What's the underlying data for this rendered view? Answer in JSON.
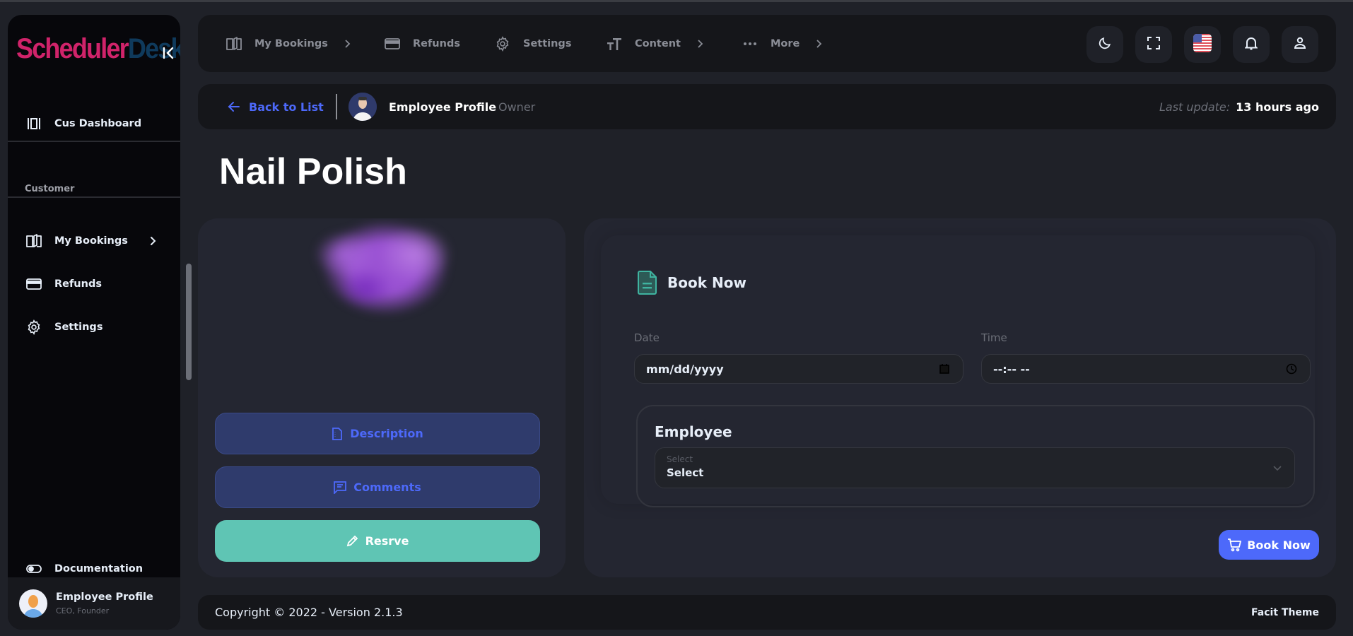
{
  "brand": {
    "part1": "Scheduler",
    "part2": "Desk"
  },
  "sidebar": {
    "dashboard": {
      "label": "Cus Dashboard",
      "icon": "dashboard-icon"
    },
    "section_label": "Customer",
    "items": [
      {
        "label": "My Bookings",
        "icon": "book-icon",
        "has_chevron": true
      },
      {
        "label": "Refunds",
        "icon": "credit-card-icon",
        "has_chevron": false
      },
      {
        "label": "Settings",
        "icon": "gear-icon",
        "has_chevron": false
      }
    ],
    "documentation": {
      "label": "Documentation",
      "icon": "toggle-icon"
    },
    "user": {
      "name": "Employee Profile",
      "role": "CEO, Founder"
    }
  },
  "header": {
    "nav": [
      {
        "label": "My Bookings",
        "icon": "book-icon",
        "has_chevron": true
      },
      {
        "label": "Refunds",
        "icon": "credit-card-icon",
        "has_chevron": false
      },
      {
        "label": "Settings",
        "icon": "gear-icon",
        "has_chevron": false
      },
      {
        "label": "Content",
        "icon": "text-size-icon",
        "has_chevron": true
      },
      {
        "label": "More",
        "icon": "more-dots-icon",
        "has_chevron": true
      }
    ],
    "actions": [
      "dark-mode-icon",
      "fullscreen-icon",
      "us-flag-icon",
      "bell-icon",
      "user-icon"
    ]
  },
  "subheader": {
    "back_label": "Back to List",
    "profile_name": "Employee Profile",
    "profile_role": "Owner",
    "last_update_label": "Last update:",
    "last_update_value": "13 hours ago"
  },
  "page": {
    "title": "Nail Polish"
  },
  "left_card": {
    "buttons": [
      {
        "label": "Description",
        "icon": "document-icon"
      },
      {
        "label": "Comments",
        "icon": "comment-icon"
      },
      {
        "label": "Resrve",
        "icon": "pencil-icon"
      }
    ]
  },
  "booking": {
    "title": "Book Now",
    "date_label": "Date",
    "date_placeholder": "mm/dd/yyyy",
    "time_label": "Time",
    "time_placeholder": "--:-- --",
    "employee_title": "Employee",
    "employee_select_placeholder": "Select",
    "employee_select_value": "Select",
    "submit_label": "Book Now"
  },
  "footer": {
    "copyright": "Copyright © 2022 - Version 2.1.3",
    "theme": "Facit Theme"
  },
  "colors": {
    "primary": "#4d69fa",
    "success": "#5fc5b4",
    "brand_pink": "#d0236a",
    "brand_navy": "#0f3a5c",
    "bg": "#1f2128",
    "panel": "#15161a",
    "card": "#242631"
  }
}
